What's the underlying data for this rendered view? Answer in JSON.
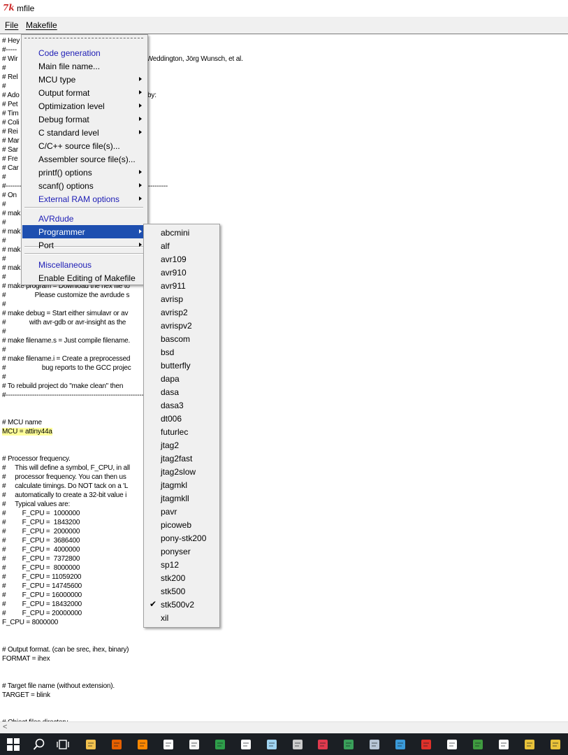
{
  "window": {
    "title": "mfile",
    "icon": "tk-feather-icon"
  },
  "menubar": {
    "file": "File",
    "makefile": "Makefile"
  },
  "editor_lines": [
    "# Hey",
    "#-----",
    "# Wir                                                                   B. Weddington, Jörg Wunsch, et al.",
    "#",
    "# Rel",
    "#",
    "# Ado                                                                tten by:",
    "# Pet",
    "# Tim",
    "# Coli",
    "# Rei",
    "# Mar",
    "# Sar",
    "# Fre",
    "# Car",
    "#",
    "#--------------------------------------------------------------------------",
    "# On",
    "#",
    "# mak",
    "#",
    "# mak",
    "#",
    "# mak",
    "#",
    "# mak",
    "#",
    "# make program = Download the hex file to                              dude.",
    "#                Please customize the avrdude s",
    "#",
    "# make debug = Start either simulavr or av                            ebugging,",
    "#             with avr-gdb or avr-insight as the                       g.",
    "#",
    "# make filename.s = Just compile filename.                            de only.",
    "#",
    "# make filename.i = Create a preprocessed                             ubmitting",
    "#                    bug reports to the GCC projec",
    "#",
    "# To rebuild project do \"make clean\" then",
    "#--------------------------------------------------------------------------",
    "",
    "",
    "# MCU name",
    "MCU = attiny44a",
    "",
    "",
    "# Processor frequency.",
    "#     This will define a symbol, F_CPU, in all                          l to the",
    "#     processor frequency. You can then us                              urce code to",
    "#     calculate timings. Do NOT tack on a 'L                            e done",
    "#     automatically to create a 32-bit value i",
    "#     Typical values are:",
    "#         F_CPU =  1000000",
    "#         F_CPU =  1843200",
    "#         F_CPU =  2000000",
    "#         F_CPU =  3686400",
    "#         F_CPU =  4000000",
    "#         F_CPU =  7372800",
    "#         F_CPU =  8000000",
    "#         F_CPU = 11059200",
    "#         F_CPU = 14745600",
    "#         F_CPU = 16000000",
    "#         F_CPU = 18432000",
    "#         F_CPU = 20000000",
    "F_CPU = 8000000",
    "",
    "",
    "# Output format. (can be srec, ihex, binary)",
    "FORMAT = ihex",
    "",
    "",
    "# Target file name (without extension).",
    "TARGET = blink",
    "",
    "",
    "# Object files directory"
  ],
  "highlighted_line": "MCU = attiny44a",
  "makefile_menu": {
    "items": [
      {
        "label": "Code generation",
        "header": true
      },
      {
        "label": "Main file name...",
        "submenu": false
      },
      {
        "label": "MCU type",
        "submenu": true
      },
      {
        "label": "Output format",
        "submenu": true
      },
      {
        "label": "Optimization level",
        "submenu": true
      },
      {
        "label": "Debug format",
        "submenu": true
      },
      {
        "label": "C standard level",
        "submenu": true
      },
      {
        "label": "C/C++ source file(s)...",
        "submenu": false
      },
      {
        "label": "Assembler source file(s)...",
        "submenu": false
      },
      {
        "label": "printf() options",
        "submenu": true
      },
      {
        "label": "scanf() options",
        "submenu": true
      },
      {
        "label": "External RAM options",
        "submenu": true,
        "blue": true
      },
      {
        "label": "AVRdude",
        "header": true
      },
      {
        "label": "Programmer",
        "submenu": true,
        "active": true
      },
      {
        "label": "Port",
        "submenu": true
      },
      {
        "label": "Miscellaneous",
        "header": true
      },
      {
        "label": "Enable Editing of Makefile",
        "submenu": false
      }
    ]
  },
  "programmer_submenu": {
    "items": [
      "abcmini",
      "alf",
      "avr109",
      "avr910",
      "avr911",
      "avrisp",
      "avrisp2",
      "avrispv2",
      "bascom",
      "bsd",
      "butterfly",
      "dapa",
      "dasa",
      "dasa3",
      "dt006",
      "futurlec",
      "jtag2",
      "jtag2fast",
      "jtag2slow",
      "jtagmkl",
      "jtagmkll",
      "pavr",
      "picoweb",
      "pony-stk200",
      "ponyser",
      "sp12",
      "stk200",
      "stk500",
      "stk500v2",
      "xil"
    ],
    "checked": "stk500v2",
    "check_glyph": "✔"
  },
  "scrollbar": {
    "left_arrow": "<"
  },
  "taskbar": {
    "icons": [
      {
        "name": "windows-start-icon",
        "color": "#ffffff"
      },
      {
        "name": "search-icon",
        "color": "#ffffff"
      },
      {
        "name": "task-view-icon",
        "color": "#ffffff"
      },
      {
        "name": "file-explorer-icon",
        "color": "#f2c14e"
      },
      {
        "name": "firefox-icon",
        "color": "#e66000"
      },
      {
        "name": "vlc-icon",
        "color": "#ff8800"
      },
      {
        "name": "mail-icon",
        "color": "#ffffff"
      },
      {
        "name": "document-icon",
        "color": "#f5f5f5"
      },
      {
        "name": "app-green-icon",
        "color": "#2e9e4a"
      },
      {
        "name": "cards-icon",
        "color": "#ffffff"
      },
      {
        "name": "notepad-icon",
        "color": "#9fd3f0"
      },
      {
        "name": "app-gray-icon",
        "color": "#cccccc"
      },
      {
        "name": "app-red-icon",
        "color": "#e03a4e"
      },
      {
        "name": "app-globe-icon",
        "color": "#3aa05a"
      },
      {
        "name": "image-viewer-icon",
        "color": "#b8c6d6"
      },
      {
        "name": "network-icon",
        "color": "#3a9ad9"
      },
      {
        "name": "pdf-icon",
        "color": "#e0312a"
      },
      {
        "name": "settings-gear-icon",
        "color": "#ffffff"
      },
      {
        "name": "spreadsheet-icon",
        "color": "#3f9b3f"
      },
      {
        "name": "store-icon",
        "color": "#ffffff"
      },
      {
        "name": "paint-icon",
        "color": "#e8c23a"
      },
      {
        "name": "tk-app-icon",
        "color": "#e8c23a"
      }
    ]
  }
}
